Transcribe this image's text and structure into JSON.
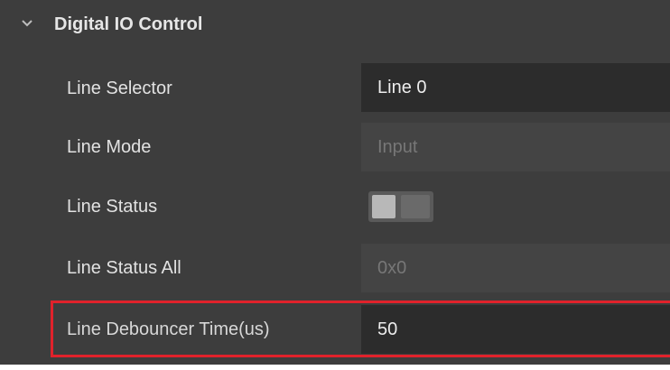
{
  "section": {
    "title": "Digital IO Control",
    "expanded": true,
    "chevron_icon": "chevron-down-icon"
  },
  "rows": [
    {
      "label": "Line Selector",
      "value": "Line 0",
      "enabled": true
    },
    {
      "label": "Line Mode",
      "value": "Input",
      "enabled": false
    },
    {
      "label": "Line Status",
      "toggle_on": false,
      "enabled": false
    },
    {
      "label": "Line Status All",
      "value": "0x0",
      "enabled": false
    },
    {
      "label": "Line Debouncer Time(us)",
      "value": "50",
      "enabled": true,
      "highlighted": true
    }
  ],
  "colors": {
    "panel_background": "#3d3d3d",
    "active_field": "#2c2c2c",
    "disabled_field": "#444444",
    "highlight": "#e0222b"
  }
}
